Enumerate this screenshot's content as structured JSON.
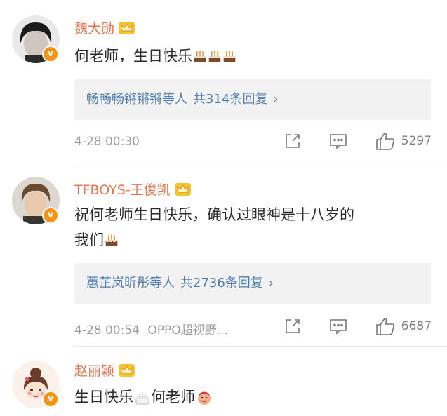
{
  "comments": [
    {
      "user": "魏大勋",
      "text": "何老师，生日快乐",
      "cakes": 3,
      "replies": "畅畅畅锵锵锵等人",
      "reply_count": "共314条回复",
      "time": "4-28 00:30",
      "likes": "5297",
      "avatar_icon": "dark-hair-avatar"
    },
    {
      "user": "TFBOYS-王俊凯",
      "text_line1": "祝何老师生日快乐，确认过眼神是十八岁的",
      "text_line2": "我们",
      "cakes": 1,
      "replies": "蕙芷岚昕彤等人",
      "reply_count": "共2736条回复",
      "time": "4-28 00:54",
      "source": "OPPO超视野...",
      "likes": "6687",
      "avatar_icon": "brown-hair-avatar"
    },
    {
      "user": "赵丽颖",
      "text_a": "生日快乐",
      "text_b": "何老师",
      "avatar_icon": "cartoon-girl-avatar"
    }
  ],
  "colors": {
    "name": "#eb7350",
    "reply_link": "#507daf",
    "meta": "#9b9b9b",
    "reply_bg": "#f2f2f2",
    "verified_badge": "#f79414"
  },
  "icons": [
    "verified-v-icon",
    "crown-icon",
    "cake-emoji",
    "share-icon",
    "comment-icon",
    "like-icon",
    "chevron-right-icon"
  ]
}
